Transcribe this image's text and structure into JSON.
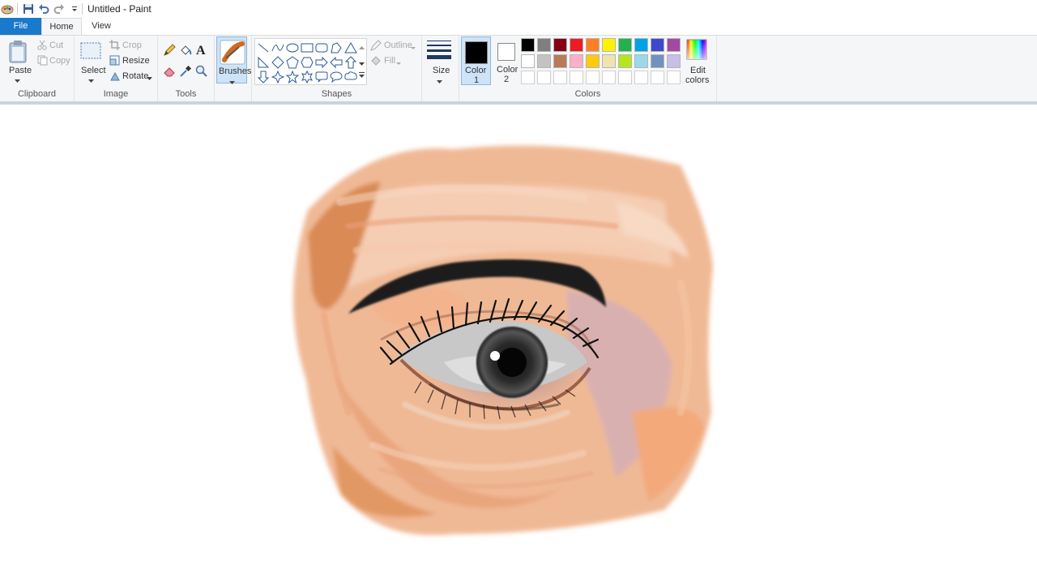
{
  "window": {
    "title": "Untitled - Paint"
  },
  "tabs": [
    {
      "label": "File"
    },
    {
      "label": "Home"
    },
    {
      "label": "View"
    }
  ],
  "clipboard": {
    "paste": "Paste",
    "cut": "Cut",
    "copy": "Copy",
    "group": "Clipboard"
  },
  "image": {
    "select": "Select",
    "crop": "Crop",
    "resize": "Resize",
    "rotate": "Rotate",
    "group": "Image"
  },
  "tools": {
    "group": "Tools",
    "icons": [
      "pencil-icon",
      "fill-icon",
      "text-icon",
      "eraser-icon",
      "color-picker-icon",
      "magnifier-icon"
    ]
  },
  "brushes": {
    "label": "Brushes"
  },
  "shapes": {
    "group": "Shapes",
    "outline": "Outline",
    "fill": "Fill"
  },
  "size": {
    "label": "Size"
  },
  "colors": {
    "color1_label": "Color 1",
    "color1_line1": "Color",
    "color1_line2": "1",
    "color2_line1": "Color",
    "color2_line2": "2",
    "color1": "#000000",
    "color2": "#ffffff",
    "edit_line1": "Edit",
    "edit_line2": "colors",
    "group": "Colors",
    "palette_row1": [
      "#000000",
      "#7f7f7f",
      "#880015",
      "#ed1c24",
      "#ff7f27",
      "#fff200",
      "#22b14c",
      "#00a2e8",
      "#3f48cc",
      "#a349a4"
    ],
    "palette_row2": [
      "#ffffff",
      "#c3c3c3",
      "#b97a57",
      "#ffaec9",
      "#ffc90e",
      "#efe4b0",
      "#b5e61d",
      "#99d9ea",
      "#7092be",
      "#c8bfe7"
    ],
    "palette_row3": [
      "#ffffff",
      "#ffffff",
      "#ffffff",
      "#ffffff",
      "#ffffff",
      "#ffffff",
      "#ffffff",
      "#ffffff",
      "#ffffff",
      "#ffffff"
    ]
  }
}
